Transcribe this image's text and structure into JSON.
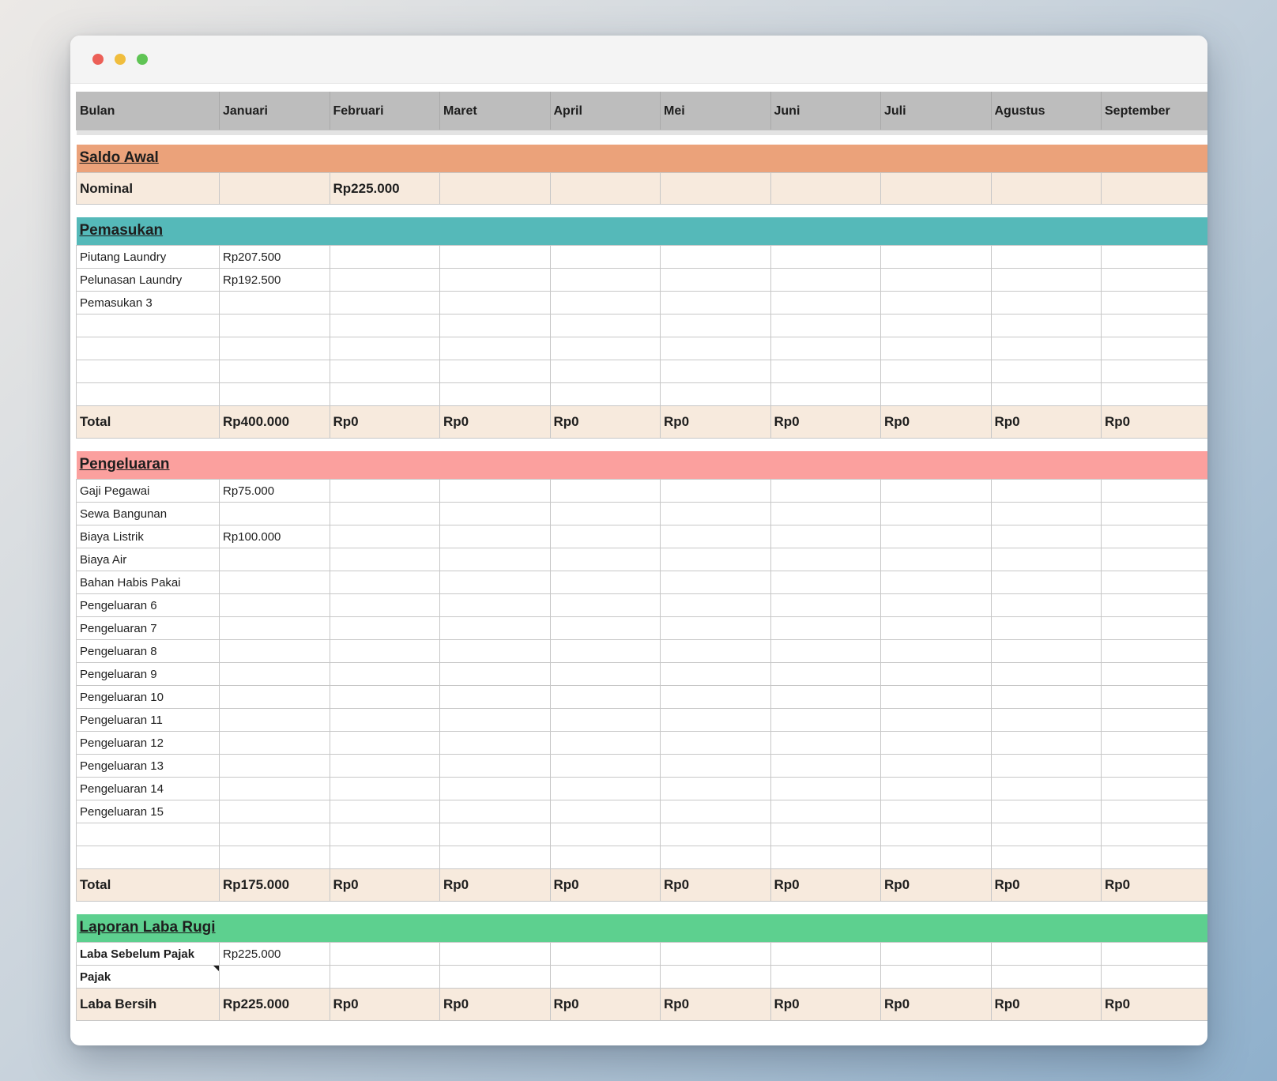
{
  "window": {
    "controls": [
      "close",
      "minimize",
      "maximize"
    ]
  },
  "header": {
    "label": "Bulan",
    "months": [
      "Januari",
      "Februari",
      "Maret",
      "April",
      "Mei",
      "Juni",
      "Juli",
      "Agustus",
      "September"
    ]
  },
  "saldo_awal": {
    "title": "Saldo Awal",
    "row": {
      "label": "Nominal",
      "values": [
        "",
        "Rp225.000",
        "",
        "",
        "",
        "",
        "",
        "",
        ""
      ]
    }
  },
  "pemasukan": {
    "title": "Pemasukan",
    "rows": [
      {
        "label": "Piutang Laundry",
        "values": [
          "Rp207.500",
          "",
          "",
          "",
          "",
          "",
          "",
          "",
          ""
        ]
      },
      {
        "label": "Pelunasan Laundry",
        "values": [
          "Rp192.500",
          "",
          "",
          "",
          "",
          "",
          "",
          "",
          ""
        ]
      },
      {
        "label": "Pemasukan 3",
        "values": [
          "",
          "",
          "",
          "",
          "",
          "",
          "",
          "",
          ""
        ]
      },
      {
        "label": "",
        "values": [
          "",
          "",
          "",
          "",
          "",
          "",
          "",
          "",
          ""
        ]
      },
      {
        "label": "",
        "values": [
          "",
          "",
          "",
          "",
          "",
          "",
          "",
          "",
          ""
        ]
      },
      {
        "label": "",
        "values": [
          "",
          "",
          "",
          "",
          "",
          "",
          "",
          "",
          ""
        ]
      },
      {
        "label": "",
        "values": [
          "",
          "",
          "",
          "",
          "",
          "",
          "",
          "",
          ""
        ]
      }
    ],
    "total": {
      "label": "Total",
      "values": [
        "Rp400.000",
        "Rp0",
        "Rp0",
        "Rp0",
        "Rp0",
        "Rp0",
        "Rp0",
        "Rp0",
        "Rp0"
      ]
    }
  },
  "pengeluaran": {
    "title": "Pengeluaran",
    "rows": [
      {
        "label": "Gaji Pegawai",
        "values": [
          "Rp75.000",
          "",
          "",
          "",
          "",
          "",
          "",
          "",
          ""
        ]
      },
      {
        "label": "Sewa Bangunan",
        "values": [
          "",
          "",
          "",
          "",
          "",
          "",
          "",
          "",
          ""
        ]
      },
      {
        "label": "Biaya Listrik",
        "values": [
          "Rp100.000",
          "",
          "",
          "",
          "",
          "",
          "",
          "",
          ""
        ]
      },
      {
        "label": "Biaya Air",
        "values": [
          "",
          "",
          "",
          "",
          "",
          "",
          "",
          "",
          ""
        ]
      },
      {
        "label": "Bahan Habis Pakai",
        "values": [
          "",
          "",
          "",
          "",
          "",
          "",
          "",
          "",
          ""
        ]
      },
      {
        "label": "Pengeluaran 6",
        "values": [
          "",
          "",
          "",
          "",
          "",
          "",
          "",
          "",
          ""
        ]
      },
      {
        "label": "Pengeluaran 7",
        "values": [
          "",
          "",
          "",
          "",
          "",
          "",
          "",
          "",
          ""
        ]
      },
      {
        "label": "Pengeluaran 8",
        "values": [
          "",
          "",
          "",
          "",
          "",
          "",
          "",
          "",
          ""
        ]
      },
      {
        "label": "Pengeluaran 9",
        "values": [
          "",
          "",
          "",
          "",
          "",
          "",
          "",
          "",
          ""
        ]
      },
      {
        "label": "Pengeluaran 10",
        "values": [
          "",
          "",
          "",
          "",
          "",
          "",
          "",
          "",
          ""
        ]
      },
      {
        "label": "Pengeluaran 11",
        "values": [
          "",
          "",
          "",
          "",
          "",
          "",
          "",
          "",
          ""
        ]
      },
      {
        "label": "Pengeluaran 12",
        "values": [
          "",
          "",
          "",
          "",
          "",
          "",
          "",
          "",
          ""
        ]
      },
      {
        "label": "Pengeluaran 13",
        "values": [
          "",
          "",
          "",
          "",
          "",
          "",
          "",
          "",
          ""
        ]
      },
      {
        "label": "Pengeluaran 14",
        "values": [
          "",
          "",
          "",
          "",
          "",
          "",
          "",
          "",
          ""
        ]
      },
      {
        "label": "Pengeluaran 15",
        "values": [
          "",
          "",
          "",
          "",
          "",
          "",
          "",
          "",
          ""
        ]
      },
      {
        "label": "",
        "values": [
          "",
          "",
          "",
          "",
          "",
          "",
          "",
          "",
          ""
        ]
      },
      {
        "label": "",
        "values": [
          "",
          "",
          "",
          "",
          "",
          "",
          "",
          "",
          ""
        ]
      }
    ],
    "total": {
      "label": "Total",
      "values": [
        "Rp175.000",
        "Rp0",
        "Rp0",
        "Rp0",
        "Rp0",
        "Rp0",
        "Rp0",
        "Rp0",
        "Rp0"
      ]
    }
  },
  "laba_rugi": {
    "title": "Laporan Laba Rugi",
    "rows": [
      {
        "label": "Laba Sebelum Pajak",
        "values": [
          "Rp225.000",
          "",
          "",
          "",
          "",
          "",
          "",
          "",
          ""
        ]
      },
      {
        "label": "Pajak",
        "values": [
          "",
          "",
          "",
          "",
          "",
          "",
          "",
          "",
          ""
        ]
      }
    ],
    "total": {
      "label": "Laba Bersih",
      "values": [
        "Rp225.000",
        "Rp0",
        "Rp0",
        "Rp0",
        "Rp0",
        "Rp0",
        "Rp0",
        "Rp0",
        "Rp0"
      ]
    }
  }
}
